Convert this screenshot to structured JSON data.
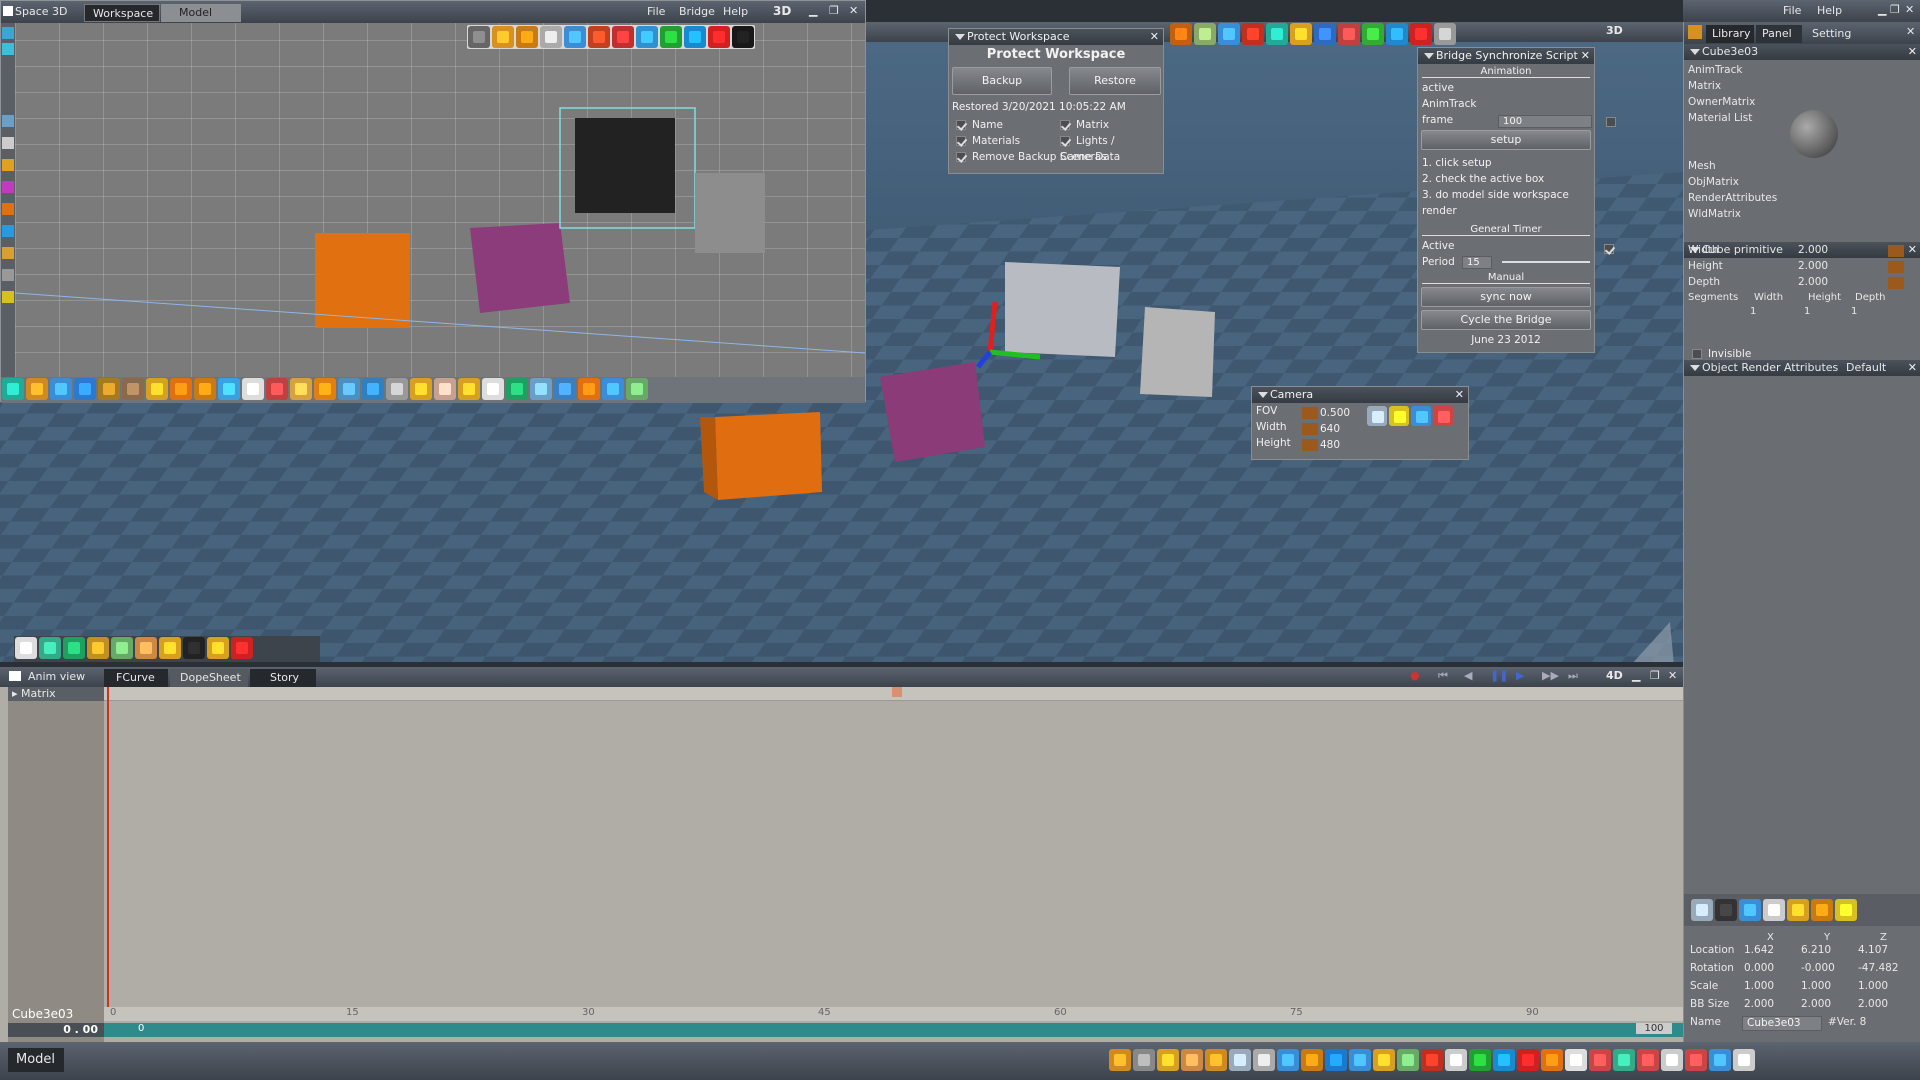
{
  "top_window": {
    "app_title": "Space 3D",
    "tabs": [
      "Workspace",
      "Model"
    ],
    "menu": [
      "File",
      "Bridge",
      "Help"
    ],
    "mode": "3D"
  },
  "main_menu": {
    "menu": [
      "File",
      "Help"
    ],
    "mode": "3D"
  },
  "protect_workspace": {
    "title": "Protect Workspace",
    "heading": "Protect Workspace",
    "backup_label": "Backup",
    "restore_label": "Restore",
    "restored_text": "Restored 3/20/2021  10:05:22 AM",
    "options": [
      {
        "label": "Name",
        "checked": true
      },
      {
        "label": "Matrix",
        "checked": true
      },
      {
        "label": "Materials",
        "checked": true
      },
      {
        "label": "Lights / Cameras",
        "checked": true
      },
      {
        "label": "Remove Backup Scene Data",
        "checked": true
      }
    ]
  },
  "bridge_script": {
    "title": "Bridge Synchronize Script",
    "animation_section": "Animation",
    "active_label": "active",
    "animtrack_label": "AnimTrack",
    "frame_label": "frame",
    "frame_value": "100",
    "setup_label": "setup",
    "steps": [
      "1. click setup",
      "2. check the active box",
      "3. do model side workspace render"
    ],
    "timer_section": "General Timer",
    "timer_active_label": "Active",
    "period_label": "Period",
    "period_value": "15",
    "manual_section": "Manual",
    "sync_label": "sync now",
    "cycle_label": "Cycle the Bridge",
    "date_label": "June 23 2012"
  },
  "camera_panel": {
    "title": "Camera",
    "fov_label": "FOV",
    "fov_value": "0.500",
    "width_label": "Width",
    "width_value": "640",
    "height_label": "Height",
    "height_value": "480"
  },
  "right_panel": {
    "tabs": [
      "Library",
      "Panel",
      "Setting"
    ],
    "object_name": "Cube3e03",
    "props": [
      "AnimTrack",
      "Matrix",
      "OwnerMatrix",
      "Material List",
      "Mesh",
      "ObjMatrix",
      "RenderAttributes",
      "WldMatrix"
    ],
    "primitive_title": "Cube primitive",
    "dims": [
      {
        "label": "Width",
        "value": "2.000"
      },
      {
        "label": "Height",
        "value": "2.000"
      },
      {
        "label": "Depth",
        "value": "2.000"
      }
    ],
    "segments_label": "Segments",
    "seg_headers": [
      "Width",
      "Height",
      "Depth"
    ],
    "seg_values": [
      "1",
      "1",
      "1"
    ],
    "render_title": "Object Render Attributes",
    "render_default": "Default",
    "invisible_label": "Invisible",
    "xyz_headers": [
      "X",
      "Y",
      "Z"
    ],
    "transform": [
      {
        "label": "Location",
        "x": "1.642",
        "y": "6.210",
        "z": "4.107"
      },
      {
        "label": "Rotation",
        "x": "0.000",
        "y": "-0.000",
        "z": "-47.482"
      },
      {
        "label": "Scale",
        "x": "1.000",
        "y": "1.000",
        "z": "1.000"
      },
      {
        "label": "BB Size",
        "x": "2.000",
        "y": "2.000",
        "z": "2.000"
      }
    ],
    "name_label": "Name",
    "name_value": "Cube3e03",
    "version": "#Ver. 8"
  },
  "anim_view": {
    "title": "Anim view",
    "tabs": [
      "FCurve",
      "DopeSheet",
      "Story"
    ],
    "track": "Matrix",
    "mode": "4D",
    "object_label": "Cube3e03",
    "time_value": "0 . 00",
    "ruler": [
      "0",
      "15",
      "30",
      "45",
      "60",
      "75",
      "90"
    ],
    "range_start": "0",
    "range_end": "100"
  },
  "status_bar": {
    "mode": "Model"
  }
}
